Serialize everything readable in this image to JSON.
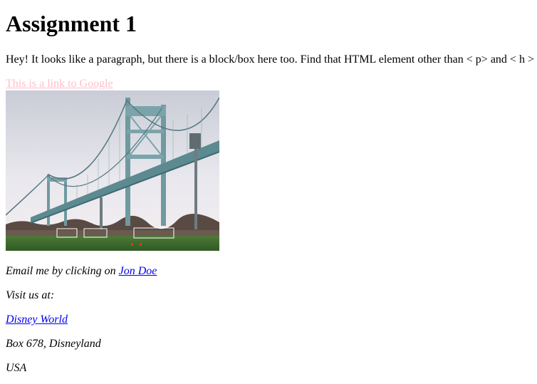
{
  "page": {
    "title": "Assignment 1",
    "intro_text": "Hey! It looks like a paragraph, but there is a block/box here too. Find that HTML element other than < p> and < h >",
    "google_link": "This is a link to Google",
    "image_alt": "Bridge over a soccer field"
  },
  "contact": {
    "email_prefix": "Email me by clicking on ",
    "email_link": "Jon Doe",
    "visit_label": "Visit us at:",
    "venue_link": "Disney World",
    "address_line": "Box 678, Disneyland",
    "country": "USA"
  },
  "colors": {
    "visited_link": "#ffc0cb",
    "link": "#0000ee"
  }
}
